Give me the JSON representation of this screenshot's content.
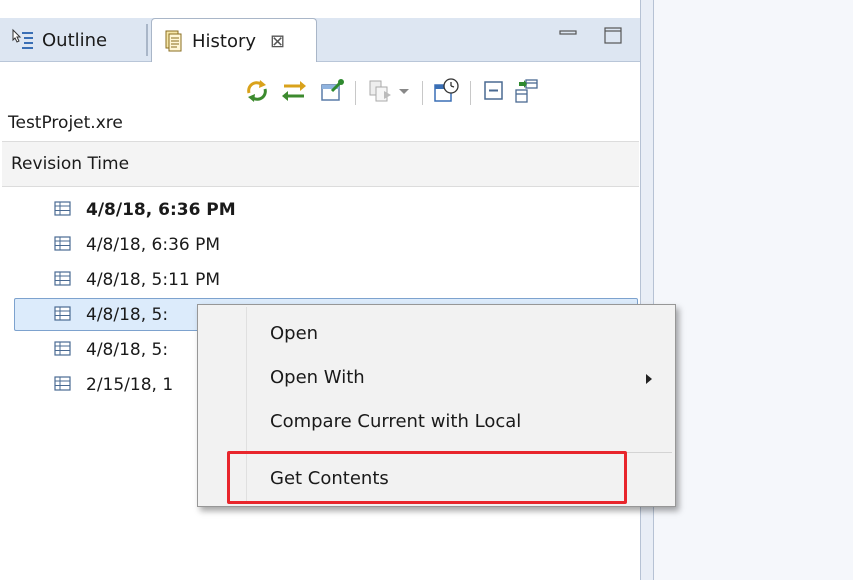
{
  "tabs": {
    "outline": "Outline",
    "history": "History",
    "close_glyph": "⊠"
  },
  "file_path": "TestProjet.xre",
  "table": {
    "column_header": "Revision Time",
    "rows": [
      {
        "label": "4/8/18, 6:36 PM",
        "bold": true
      },
      {
        "label": "4/8/18, 6:36 PM",
        "bold": false
      },
      {
        "label": "4/8/18, 5:11 PM",
        "bold": false
      },
      {
        "label": "4/8/18, 5:",
        "bold": false,
        "selected": true
      },
      {
        "label": "4/8/18, 5:",
        "bold": false
      },
      {
        "label": "2/15/18, 1",
        "bold": false
      }
    ]
  },
  "context_menu": {
    "open": "Open",
    "open_with": "Open With",
    "compare": "Compare Current with Local",
    "get_contents": "Get Contents"
  },
  "colors": {
    "highlight": "#e8262c",
    "selection": "#dcebfb",
    "tab_strip": "#dde6f2"
  },
  "icons": {
    "outline_tab": "outline-icon",
    "history_tab": "history-icon",
    "toolbar": [
      "refresh-icon",
      "link-editor-icon",
      "pin-icon",
      "compare-mode-icon",
      "dropdown-icon",
      "group-by-date-icon",
      "collapse-all-icon",
      "layout-icon"
    ],
    "row": "table-grid-icon"
  }
}
